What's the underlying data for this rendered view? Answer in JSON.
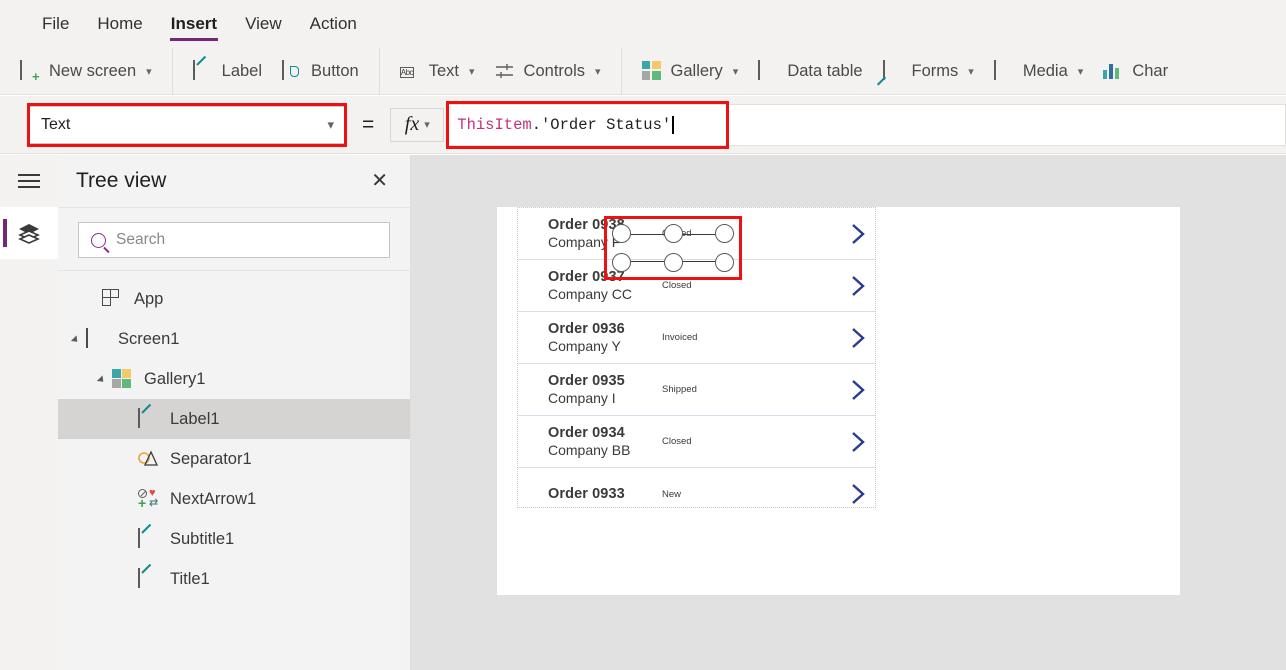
{
  "menu": {
    "tabs": [
      {
        "label": "File",
        "active": false
      },
      {
        "label": "Home",
        "active": false
      },
      {
        "label": "Insert",
        "active": true
      },
      {
        "label": "View",
        "active": false
      },
      {
        "label": "Action",
        "active": false
      }
    ]
  },
  "ribbon": {
    "items": [
      {
        "label": "New screen",
        "icon": "new-screen-icon",
        "caret": true
      },
      {
        "label": "Label",
        "icon": "label-icon",
        "caret": false
      },
      {
        "label": "Button",
        "icon": "button-icon",
        "caret": false
      },
      {
        "label": "Text",
        "icon": "text-abc-icon",
        "caret": true
      },
      {
        "label": "Controls",
        "icon": "controls-icon",
        "caret": true
      },
      {
        "label": "Gallery",
        "icon": "gallery-icon",
        "caret": true
      },
      {
        "label": "Data table",
        "icon": "data-table-icon",
        "caret": false
      },
      {
        "label": "Forms",
        "icon": "forms-icon",
        "caret": true
      },
      {
        "label": "Media",
        "icon": "media-icon",
        "caret": true
      },
      {
        "label": "Char",
        "icon": "charts-icon",
        "caret": false
      }
    ]
  },
  "property_bar": {
    "selected_property": "Text",
    "equals": "=",
    "fx_label": "fx",
    "formula": {
      "object": "ThisItem",
      "rest": ".'Order Status'"
    }
  },
  "tree_view": {
    "title": "Tree view",
    "close_label": "✕",
    "search": {
      "placeholder": "Search",
      "value": ""
    },
    "items": [
      {
        "label": "App",
        "icon": "app-icon",
        "depth": 0,
        "caret": false,
        "selected": false
      },
      {
        "label": "Screen1",
        "icon": "screen-icon",
        "depth": 0,
        "caret": true,
        "selected": false
      },
      {
        "label": "Gallery1",
        "icon": "gallery-icon",
        "depth": 1,
        "caret": true,
        "selected": false
      },
      {
        "label": "Label1",
        "icon": "label-icon",
        "depth": 2,
        "caret": false,
        "selected": true
      },
      {
        "label": "Separator1",
        "icon": "separator-icon",
        "depth": 2,
        "caret": false,
        "selected": false
      },
      {
        "label": "NextArrow1",
        "icon": "next-arrow-icon",
        "depth": 2,
        "caret": false,
        "selected": false
      },
      {
        "label": "Subtitle1",
        "icon": "label-icon",
        "depth": 2,
        "caret": false,
        "selected": false
      },
      {
        "label": "Title1",
        "icon": "label-icon",
        "depth": 2,
        "caret": false,
        "selected": false
      }
    ]
  },
  "canvas": {
    "gallery_rows": [
      {
        "title": "Order 0938",
        "subtitle": "Company F",
        "status": "Closed"
      },
      {
        "title": "Order 0937",
        "subtitle": "Company CC",
        "status": "Closed"
      },
      {
        "title": "Order 0936",
        "subtitle": "Company Y",
        "status": "Invoiced"
      },
      {
        "title": "Order 0935",
        "subtitle": "Company I",
        "status": "Shipped"
      },
      {
        "title": "Order 0934",
        "subtitle": "Company BB",
        "status": "Closed"
      },
      {
        "title": "Order 0933",
        "subtitle": "",
        "status": "New"
      }
    ]
  },
  "colors": {
    "accent_purple": "#742774",
    "selection_red": "#ee1111",
    "chevron_blue": "#2b3a8f",
    "canvas_bg": "#e1e1e1",
    "panel_bg": "#f3f3f3",
    "ribbon_bg": "#f3f2f1"
  }
}
